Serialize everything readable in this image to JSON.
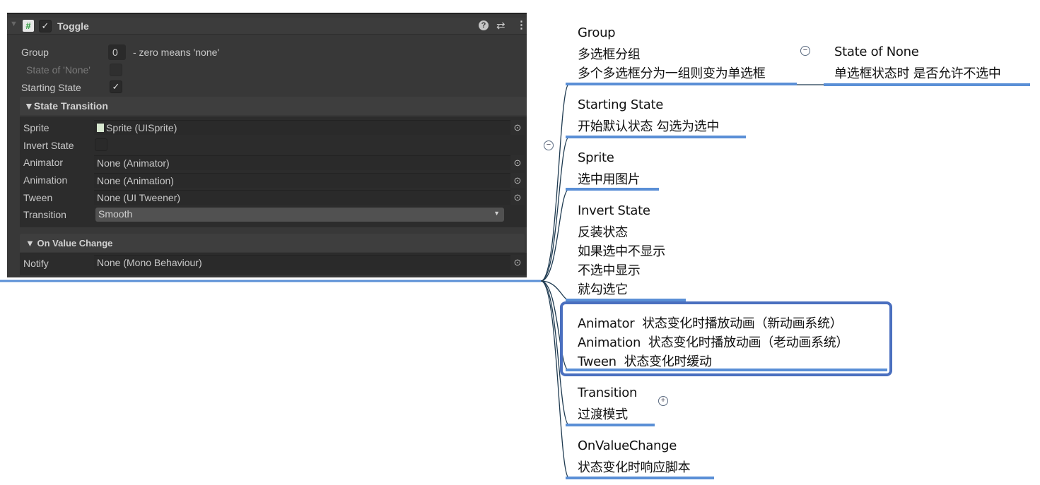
{
  "inspector": {
    "component_title": "Toggle",
    "group_label": "Group",
    "group_value": "0",
    "group_hint": "- zero means 'none'",
    "state_none_label": "State of 'None'",
    "starting_state_label": "Starting State",
    "state_transition_header": "▼State Transition",
    "rows": [
      {
        "label": "Sprite",
        "value": "Sprite (UISprite)"
      },
      {
        "label": "Invert State"
      },
      {
        "label": "Animator",
        "value": "None (Animator)"
      },
      {
        "label": "Animation",
        "value": "None (Animation)"
      },
      {
        "label": "Tween",
        "value": "None (UI Tweener)"
      },
      {
        "label": "Transition",
        "value": "Smooth"
      }
    ],
    "on_value_change_header": "▼ On Value Change",
    "notify_label": "Notify",
    "notify_value": "None (Mono Behaviour)"
  },
  "mindmap": {
    "group": [
      "Group",
      "多选框分组",
      "多个多选框分为一组则变为单选框"
    ],
    "state_of_none": [
      "State of None",
      "单选框状态时 是否允许不选中"
    ],
    "starting_state": [
      "Starting State",
      "开始默认状态 勾选为选中"
    ],
    "sprite": [
      "Sprite",
      "选中用图片"
    ],
    "invert_state": [
      "Invert State",
      "反装状态",
      "如果选中不显示",
      "不选中显示",
      "就勾选它"
    ],
    "animation_box": [
      {
        "name": "Animator",
        "desc": "状态变化时播放动画（新动画系统）"
      },
      {
        "name": "Animation",
        "desc": "状态变化时播放动画（老动画系统）"
      },
      {
        "name": "Tween",
        "desc": "状态变化时缓动"
      }
    ],
    "transition": [
      "Transition",
      "过渡模式"
    ],
    "on_value_change": [
      "OnValueChange",
      "状态变化时响应脚本"
    ]
  },
  "colors": {
    "accent": "#5a8fd6",
    "box_border": "#4a6fbf"
  }
}
